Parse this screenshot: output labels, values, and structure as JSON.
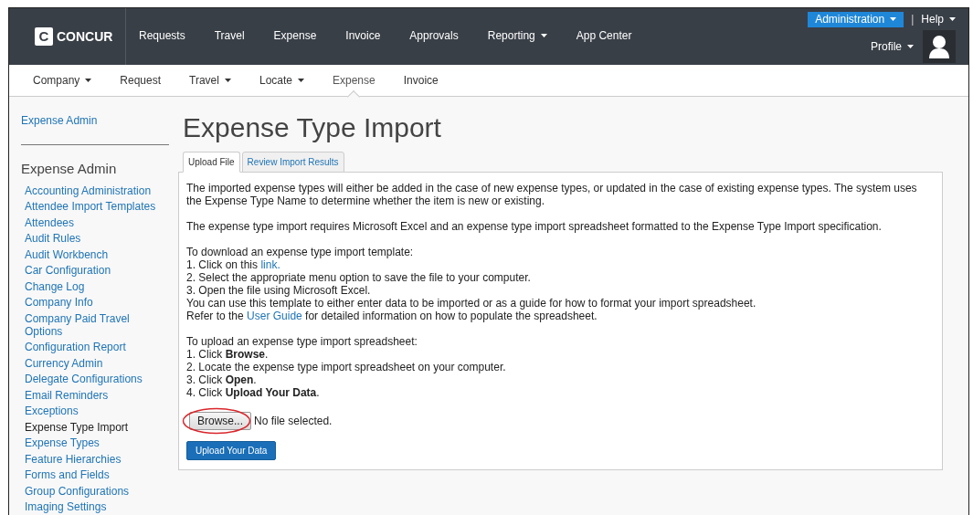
{
  "brand": {
    "logo_letter": "C",
    "name": "CONCUR"
  },
  "top_nav": [
    {
      "label": "Requests",
      "dropdown": false
    },
    {
      "label": "Travel",
      "dropdown": false
    },
    {
      "label": "Expense",
      "dropdown": false
    },
    {
      "label": "Invoice",
      "dropdown": false
    },
    {
      "label": "Approvals",
      "dropdown": false
    },
    {
      "label": "Reporting",
      "dropdown": true
    },
    {
      "label": "App Center",
      "dropdown": false
    }
  ],
  "admin_menu": {
    "label": "Administration",
    "separator": "|",
    "help": "Help",
    "profile": "Profile"
  },
  "sub_nav": [
    {
      "label": "Company",
      "dropdown": true,
      "selected": false
    },
    {
      "label": "Request",
      "dropdown": false,
      "selected": false
    },
    {
      "label": "Travel",
      "dropdown": true,
      "selected": false
    },
    {
      "label": "Locate",
      "dropdown": true,
      "selected": false
    },
    {
      "label": "Expense",
      "dropdown": false,
      "selected": true
    },
    {
      "label": "Invoice",
      "dropdown": false,
      "selected": false
    }
  ],
  "sidebar": {
    "breadcrumb": "Expense Admin",
    "heading": "Expense Admin",
    "items": [
      {
        "label": "Accounting Administration",
        "selected": false
      },
      {
        "label": "Attendee Import Templates",
        "selected": false
      },
      {
        "label": "Attendees",
        "selected": false
      },
      {
        "label": "Audit Rules",
        "selected": false
      },
      {
        "label": "Audit Workbench",
        "selected": false
      },
      {
        "label": "Car Configuration",
        "selected": false
      },
      {
        "label": "Change Log",
        "selected": false
      },
      {
        "label": "Company Info",
        "selected": false
      },
      {
        "label": "Company Paid Travel Options",
        "selected": false
      },
      {
        "label": "Configuration Report",
        "selected": false
      },
      {
        "label": "Currency Admin",
        "selected": false
      },
      {
        "label": "Delegate Configurations",
        "selected": false
      },
      {
        "label": "Email Reminders",
        "selected": false
      },
      {
        "label": "Exceptions",
        "selected": false
      },
      {
        "label": "Expense Type Import",
        "selected": true
      },
      {
        "label": "Expense Types",
        "selected": false
      },
      {
        "label": "Feature Hierarchies",
        "selected": false
      },
      {
        "label": "Forms and Fields",
        "selected": false
      },
      {
        "label": "Group Configurations",
        "selected": false
      },
      {
        "label": "Imaging Settings",
        "selected": false
      }
    ]
  },
  "page_title": "Expense Type Import",
  "tabs": [
    {
      "label": "Upload File",
      "selected": true
    },
    {
      "label": "Review Import Results",
      "selected": false
    }
  ],
  "content": [
    {
      "lines": [
        {
          "text": "The imported expense types will either be added in the case of new expense types, or updated in the case of existing expense types. The system uses the Expense Type Name to determine whether the item is new or existing."
        }
      ]
    },
    {
      "lines": [
        {
          "text": "The expense type import requires Microsoft Excel and an expense type import spreadsheet formatted to the Expense Type Import specification."
        }
      ]
    },
    {
      "lines": [
        {
          "text": "To download an expense type import template:"
        },
        {
          "text": "1. Click on this ",
          "link": "link."
        },
        {
          "text": "2. Select the appropriate menu option to save the file to your computer."
        },
        {
          "text": "3. Open the file using Microsoft Excel."
        },
        {
          "text": "You can use this template to either enter data to be imported or as a guide for how to format your import spreadsheet."
        },
        {
          "text": "Refer to the ",
          "link": "User Guide",
          "after": " for detailed information on how to populate the spreadsheet."
        }
      ]
    },
    {
      "lines": [
        {
          "text": "To upload an expense type import spreadsheet:"
        },
        {
          "text": "1. Click **Browse**."
        },
        {
          "text": "2. Locate the expense type import spreadsheet on your computer."
        },
        {
          "text": "3. Click **Open**."
        },
        {
          "text": "4. Click **Upload Your Data**."
        }
      ]
    }
  ],
  "file_input": {
    "button": "Browse...",
    "status": "No file selected.",
    "highlighted": true
  },
  "upload_button": "Upload Your Data"
}
